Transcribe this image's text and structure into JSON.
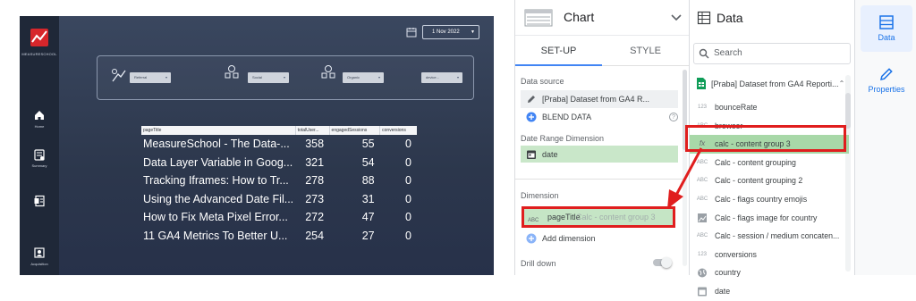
{
  "report": {
    "logo_text": "MEASURESCHOOL",
    "nav": [
      {
        "label": "Home",
        "icon": "home-icon"
      },
      {
        "label": "Summary",
        "icon": "summary-icon"
      },
      {
        "label": "",
        "icon": "document-icon"
      },
      {
        "label": "Acquisition",
        "icon": "acquisition-icon"
      }
    ],
    "date_range": "1 Nov 2022",
    "filters": [
      "Referral",
      "Social",
      "Organic",
      "device..."
    ],
    "table": {
      "headers": [
        "pageTitle",
        "totalUser...",
        "engagedSessions",
        "conversions"
      ],
      "rows": [
        [
          "MeasureSchool - The Data-...",
          "358",
          "55",
          "0"
        ],
        [
          "Data Layer Variable in Goog...",
          "321",
          "54",
          "0"
        ],
        [
          "Tracking Iframes: How to Tr...",
          "278",
          "88",
          "0"
        ],
        [
          "Using the Advanced Date Fil...",
          "273",
          "31",
          "0"
        ],
        [
          "How to Fix Meta Pixel Error...",
          "272",
          "47",
          "0"
        ],
        [
          "11 GA4 Metrics To Better U...",
          "254",
          "27",
          "0"
        ]
      ]
    }
  },
  "chart_panel": {
    "title": "Chart",
    "tabs": [
      "SET-UP",
      "STYLE"
    ],
    "data_source_label": "Data source",
    "data_source": "[Praba] Dataset from GA4 R...",
    "blend_data": "BLEND DATA",
    "date_range_label": "Date Range Dimension",
    "date_dimension": "date",
    "dimension_label": "Dimension",
    "dimension_value": "pageTitle",
    "dimension_ghost": "Calc - content group 3",
    "add_dimension": "Add dimension",
    "drill_down": "Drill down"
  },
  "data_panel": {
    "title": "Data",
    "search_placeholder": "Search",
    "source": "[Praba] Dataset from GA4 Reporti...",
    "fields": [
      {
        "type": "123",
        "name": "bounceRate"
      },
      {
        "type": "ABC",
        "name": "browser"
      },
      {
        "type": "fx",
        "name": "calc - content group 3"
      },
      {
        "type": "ABC",
        "name": "Calc - content grouping"
      },
      {
        "type": "ABC",
        "name": "Calc - content grouping 2"
      },
      {
        "type": "ABC",
        "name": "Calc - flags country emojis"
      },
      {
        "type": "image",
        "name": "Calc - flags image for country"
      },
      {
        "type": "ABC",
        "name": "Calc - session / medium concaten..."
      },
      {
        "type": "123",
        "name": "conversions"
      },
      {
        "type": "globe",
        "name": "country"
      },
      {
        "type": "calendar",
        "name": "date"
      }
    ]
  },
  "rail": [
    {
      "label": "Data",
      "icon": "data-table-icon"
    },
    {
      "label": "Properties",
      "icon": "pencil-icon"
    }
  ],
  "colors": {
    "highlight_red": "#e01e1e",
    "highlight_green": "#a8d8a8",
    "accent_blue": "#1a73e8"
  }
}
